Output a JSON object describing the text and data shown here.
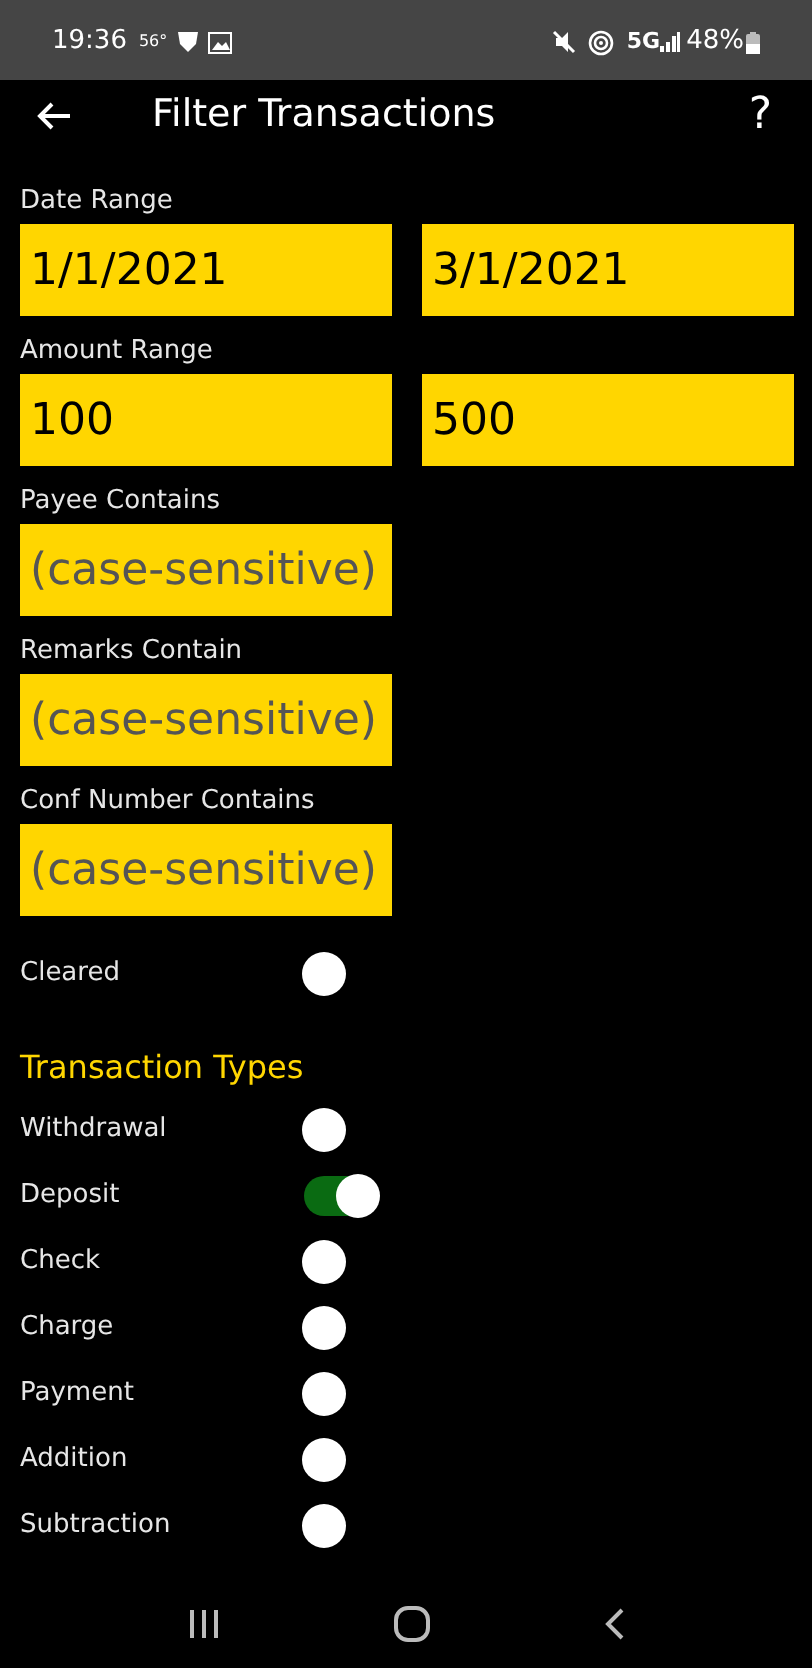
{
  "status_bar": {
    "time": "19:36",
    "temperature": "56°",
    "battery": "48%",
    "network": "5G"
  },
  "app_bar": {
    "title": "Filter Transactions",
    "help": "?"
  },
  "date_range": {
    "label": "Date Range",
    "from": "1/1/2021",
    "to": "3/1/2021"
  },
  "amount_range": {
    "label": "Amount Range",
    "from": "100",
    "to": "500"
  },
  "text_filters": [
    {
      "label": "Payee Contains",
      "placeholder": "(case-sensitive)"
    },
    {
      "label": "Remarks Contain",
      "placeholder": "(case-sensitive)"
    },
    {
      "label": "Conf Number Contains",
      "placeholder": "(case-sensitive)"
    }
  ],
  "cleared": {
    "label": "Cleared",
    "on": false
  },
  "transaction_types": {
    "heading": "Transaction Types",
    "items": [
      {
        "label": "Withdrawal",
        "on": false
      },
      {
        "label": "Deposit",
        "on": true
      },
      {
        "label": "Check",
        "on": false
      },
      {
        "label": "Charge",
        "on": false
      },
      {
        "label": "Payment",
        "on": false
      },
      {
        "label": "Addition",
        "on": false
      },
      {
        "label": "Subtraction",
        "on": false
      }
    ]
  }
}
